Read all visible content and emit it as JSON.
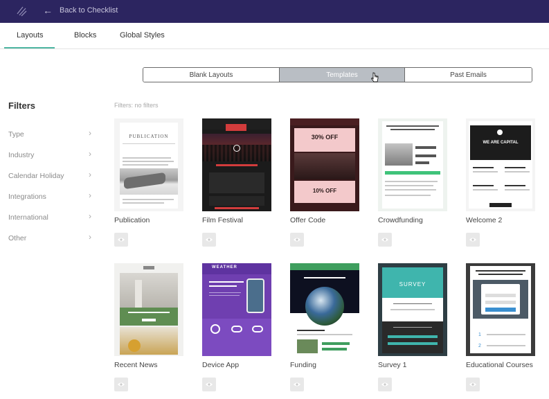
{
  "topbar": {
    "back_label": "Back to Checklist"
  },
  "tabs": [
    {
      "label": "Layouts",
      "active": true
    },
    {
      "label": "Blocks",
      "active": false
    },
    {
      "label": "Global Styles",
      "active": false
    }
  ],
  "segmented": [
    {
      "label": "Blank Layouts",
      "active": false
    },
    {
      "label": "Templates",
      "active": true
    },
    {
      "label": "Past Emails",
      "active": false
    }
  ],
  "filters": {
    "title": "Filters",
    "note": "Filters: no filters",
    "items": [
      {
        "label": "Type"
      },
      {
        "label": "Industry"
      },
      {
        "label": "Calendar Holiday"
      },
      {
        "label": "Integrations"
      },
      {
        "label": "International"
      },
      {
        "label": "Other"
      }
    ]
  },
  "templates": [
    {
      "name": "Publication",
      "thumb_title": "PUBLICATION"
    },
    {
      "name": "Film Festival",
      "thumb_title": ""
    },
    {
      "name": "Offer Code",
      "thumb_title": "30% OFF",
      "thumb_sub": "10% OFF"
    },
    {
      "name": "Crowdfunding",
      "thumb_title": ""
    },
    {
      "name": "Welcome 2",
      "thumb_title": "WE ARE CAPITAL"
    },
    {
      "name": "Recent News",
      "thumb_title": ""
    },
    {
      "name": "Device App",
      "thumb_title": "WEATHER"
    },
    {
      "name": "Funding",
      "thumb_title": ""
    },
    {
      "name": "Survey 1",
      "thumb_title": "SURVEY"
    },
    {
      "name": "Educational Courses",
      "thumb_title": ""
    }
  ],
  "colors": {
    "topbar": "#2c2560",
    "accent": "#4db6a2",
    "segment_active": "#b9bec4"
  }
}
